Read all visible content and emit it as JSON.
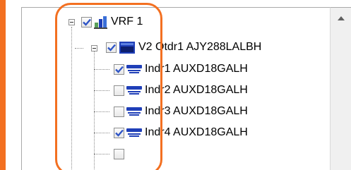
{
  "tree": {
    "root": {
      "label": "VRF 1",
      "checked": true,
      "icon": "network-device-icon"
    },
    "outdoor": {
      "label": "V2 Otdr1 AJY288LALBH",
      "checked": true,
      "icon": "outdoor-unit-icon"
    },
    "indoor_units": [
      {
        "label": "Indr1 AUXD18GALH",
        "checked": true,
        "icon": "indoor-unit-icon"
      },
      {
        "label": "Indr2 AUXD18GALH",
        "checked": false,
        "icon": "indoor-unit-icon"
      },
      {
        "label": "Indr3 AUXD18GALH",
        "checked": false,
        "icon": "indoor-unit-icon"
      },
      {
        "label": "Indr4 AUXD18GALH",
        "checked": true,
        "icon": "indoor-unit-icon"
      }
    ]
  },
  "colors": {
    "accent": "#f37021",
    "check": "#2f55c6",
    "unit_icon": "#1f3fb8"
  }
}
